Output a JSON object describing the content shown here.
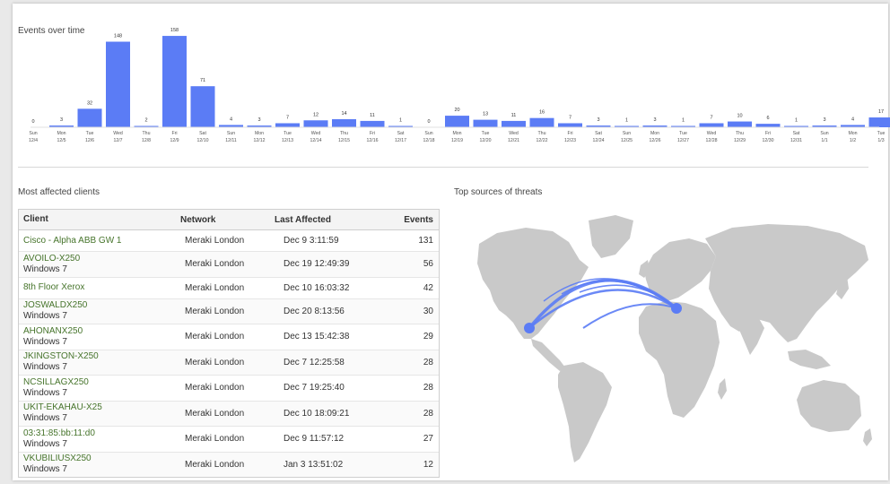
{
  "chart": {
    "title": "Events over time"
  },
  "chart_data": {
    "type": "bar",
    "title": "Events over time",
    "xlabel": "",
    "ylabel": "",
    "ylim": [
      0,
      155
    ],
    "categories": [
      [
        "Sun",
        "12/4"
      ],
      [
        "Mon",
        "12/5"
      ],
      [
        "Tue",
        "12/6"
      ],
      [
        "Wed",
        "12/7"
      ],
      [
        "Thu",
        "12/8"
      ],
      [
        "Fri",
        "12/9"
      ],
      [
        "Sat",
        "12/10"
      ],
      [
        "Sun",
        "12/11"
      ],
      [
        "Mon",
        "12/12"
      ],
      [
        "Tue",
        "12/13"
      ],
      [
        "Wed",
        "12/14"
      ],
      [
        "Thu",
        "12/15"
      ],
      [
        "Fri",
        "12/16"
      ],
      [
        "Sat",
        "12/17"
      ],
      [
        "Sun",
        "12/18"
      ],
      [
        "Mon",
        "12/19"
      ],
      [
        "Tue",
        "12/20"
      ],
      [
        "Wed",
        "12/21"
      ],
      [
        "Thu",
        "12/22"
      ],
      [
        "Fri",
        "12/23"
      ],
      [
        "Sat",
        "12/24"
      ],
      [
        "Sun",
        "12/25"
      ],
      [
        "Mon",
        "12/26"
      ],
      [
        "Tue",
        "12/27"
      ],
      [
        "Wed",
        "12/28"
      ],
      [
        "Thu",
        "12/29"
      ],
      [
        "Fri",
        "12/30"
      ],
      [
        "Sat",
        "12/31"
      ],
      [
        "Sun",
        "1/1"
      ],
      [
        "Mon",
        "1/2"
      ],
      [
        "Tue",
        "1/3"
      ]
    ],
    "values": [
      0,
      3,
      32,
      148,
      2,
      158,
      71,
      4,
      3,
      7,
      12,
      14,
      11,
      1,
      0,
      20,
      13,
      11,
      16,
      7,
      3,
      1,
      3,
      1,
      7,
      10,
      6,
      1,
      3,
      4,
      17
    ],
    "color": "#5b7cf5"
  },
  "clients": {
    "title": "Most affected clients",
    "headers": {
      "client": "Client",
      "network": "Network",
      "last": "Last Affected",
      "events": "Events"
    },
    "rows": [
      {
        "name": "Cisco - Alpha ABB GW 1",
        "os": "",
        "network": "Meraki London",
        "last": "Dec 9 3:11:59",
        "events": "131"
      },
      {
        "name": "AVOILO-X250",
        "os": "Windows 7",
        "network": "Meraki London",
        "last": "Dec 19 12:49:39",
        "events": "56"
      },
      {
        "name": "8th Floor Xerox",
        "os": "",
        "network": "Meraki London",
        "last": "Dec 10 16:03:32",
        "events": "42"
      },
      {
        "name": "JOSWALDX250",
        "os": "Windows 7",
        "network": "Meraki London",
        "last": "Dec 20 8:13:56",
        "events": "30"
      },
      {
        "name": "AHONANX250",
        "os": "Windows 7",
        "network": "Meraki London",
        "last": "Dec 13 15:42:38",
        "events": "29"
      },
      {
        "name": "JKINGSTON-X250",
        "os": "Windows 7",
        "network": "Meraki London",
        "last": "Dec 7 12:25:58",
        "events": "28"
      },
      {
        "name": "NCSILLAGX250",
        "os": "Windows 7",
        "network": "Meraki London",
        "last": "Dec 7 19:25:40",
        "events": "28"
      },
      {
        "name": "UKIT-EKAHAU-X25",
        "os": "Windows 7",
        "network": "Meraki London",
        "last": "Dec 10 18:09:21",
        "events": "28"
      },
      {
        "name": "03:31:85:bb:11:d0",
        "os": "Windows 7",
        "network": "Meraki London",
        "last": "Dec 9 11:57:12",
        "events": "27"
      },
      {
        "name": "VKUBILIUSX250",
        "os": "Windows 7",
        "network": "Meraki London",
        "last": "Jan 3 13:51:02",
        "events": "12"
      }
    ]
  },
  "map": {
    "title": "Top sources of threats",
    "land_color": "#c9c9c9",
    "arc_color": "#5b7cf5"
  }
}
